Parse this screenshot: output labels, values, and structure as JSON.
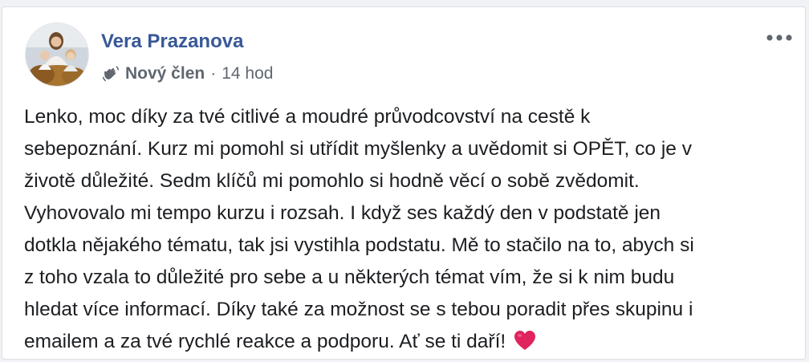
{
  "post": {
    "author": {
      "name": "Vera Prazanova",
      "avatar_icon": "profile-photo-icon"
    },
    "meta": {
      "badge_icon": "waving-hand-icon",
      "badge": "Nový člen",
      "separator": "·",
      "timestamp": "14 hod"
    },
    "menu_icon": "more-options-icon",
    "body_lines": [
      "Lenko, moc díky za tvé citlivé a moudré průvodcovství na cestě k",
      "sebepoznání. Kurz mi pomohl si utřídit myšlenky a uvědomit si OPĚT, co je v",
      "životě důležité. Sedm klíčů mi pomohlo si hodně věcí o sobě zvědomit.",
      "Vyhovovalo mi tempo kurzu i rozsah. I když ses každý den v podstatě jen",
      "dotkla nějakého tématu, tak jsi vystihla podstatu. Mě to stačilo na to, abych si",
      "z toho vzala to důležité pro sebe a u některých témat vím, že si k nim budu",
      "hledat více informací. Díky také za možnost se s tebou poradit přes skupinu i",
      "emailem a za tvé rychlé reakce a podporu. Ať se ti daří!"
    ],
    "emoji": "red-heart-icon"
  },
  "colors": {
    "author_link": "#385898",
    "secondary_text": "#606770",
    "body_text": "#1c1e21",
    "heart": "#e0245e"
  }
}
